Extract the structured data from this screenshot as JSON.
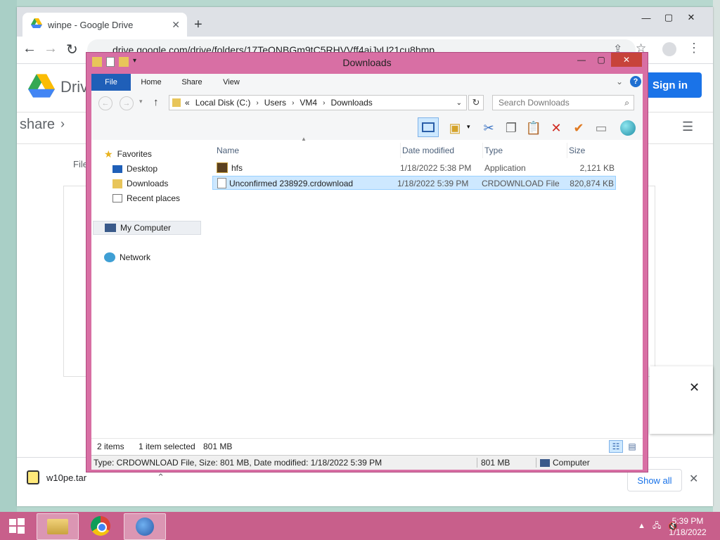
{
  "chrome": {
    "tab_title": "winpe - Google Drive",
    "url": "drive.google.com/drive/folders/17TeQNBGm9tC5RHVVff4aiJyU21cu8hmp",
    "brand_partial": "Driv",
    "signin_label": "Sign in",
    "breadcrumb_partial": "share",
    "file_partial": "File",
    "download_file": "w10pe.tar",
    "show_all": "Show all"
  },
  "explorer": {
    "title": "Downloads",
    "ribbon_tabs": [
      "File",
      "Home",
      "Share",
      "View"
    ],
    "address": {
      "prefix": "«",
      "crumbs": [
        "Local Disk (C:)",
        "Users",
        "VM4",
        "Downloads"
      ]
    },
    "search_placeholder": "Search Downloads",
    "nav": {
      "favorites": "Favorites",
      "desktop": "Desktop",
      "downloads": "Downloads",
      "recent": "Recent places",
      "computer": "My Computer",
      "network": "Network"
    },
    "columns": {
      "name": "Name",
      "date": "Date modified",
      "type": "Type",
      "size": "Size"
    },
    "files": [
      {
        "name": "hfs",
        "date": "1/18/2022 5:38 PM",
        "type": "Application",
        "size": "2,121 KB"
      },
      {
        "name": "Unconfirmed 238929.crdownload",
        "date": "1/18/2022 5:39 PM",
        "type": "CRDOWNLOAD File",
        "size": "820,874 KB"
      }
    ],
    "status": {
      "items": "2 items",
      "selected": "1 item selected",
      "selected_size": "801 MB"
    },
    "details": {
      "text": "Type: CRDOWNLOAD File, Size: 801 MB, Date modified: 1/18/2022 5:39 PM",
      "size": "801 MB",
      "location": "Computer"
    }
  },
  "taskbar": {
    "time": "5:39 PM",
    "date": "1/18/2022"
  },
  "colors": {
    "explorer_frame": "#d86fa4",
    "taskbar": "#c85f8b",
    "selection": "#cde8ff",
    "google_blue": "#1a73e8"
  }
}
